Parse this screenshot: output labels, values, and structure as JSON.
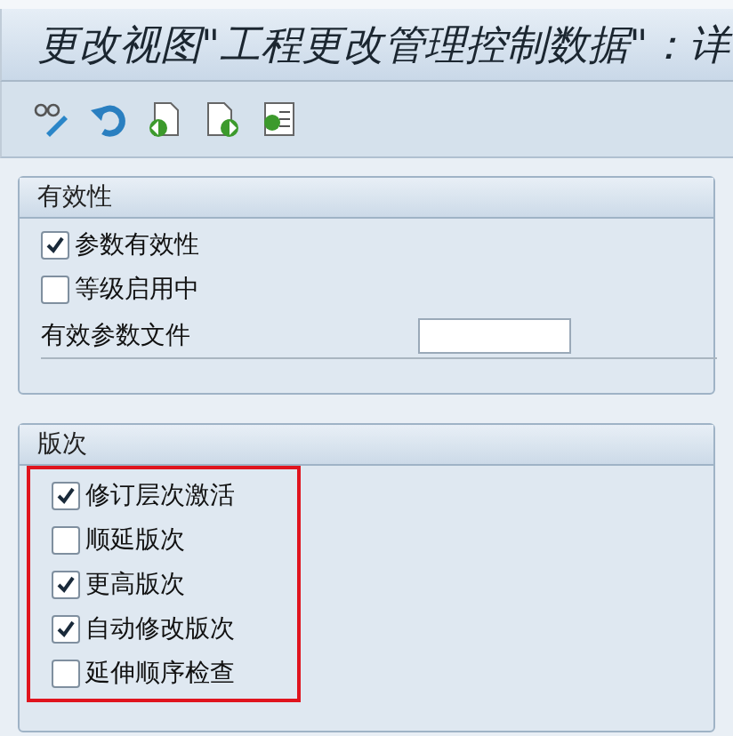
{
  "window": {
    "title": "更改视图\"工程更改管理控制数据\"：详"
  },
  "toolbar": {
    "buttons": [
      {
        "kind": "display-change"
      },
      {
        "kind": "undo"
      },
      {
        "kind": "previous"
      },
      {
        "kind": "next"
      },
      {
        "kind": "other"
      }
    ]
  },
  "groups": [
    {
      "title": "有效性",
      "highlighted": false,
      "items": [
        {
          "kind": "checkbox",
          "label": "参数有效性",
          "checked": true
        },
        {
          "kind": "checkbox",
          "label": "等级启用中",
          "checked": false
        },
        {
          "kind": "field",
          "label": "有效参数文件"
        }
      ]
    },
    {
      "title": "版次",
      "highlighted": true,
      "items": [
        {
          "kind": "checkbox",
          "label": "修订层次激活",
          "checked": true
        },
        {
          "kind": "checkbox",
          "label": "顺延版次",
          "checked": false
        },
        {
          "kind": "checkbox",
          "label": "更高版次",
          "checked": true
        },
        {
          "kind": "checkbox",
          "label": "自动修改版次",
          "checked": true
        },
        {
          "kind": "checkbox",
          "label": "延伸顺序检查",
          "checked": false
        }
      ]
    }
  ]
}
